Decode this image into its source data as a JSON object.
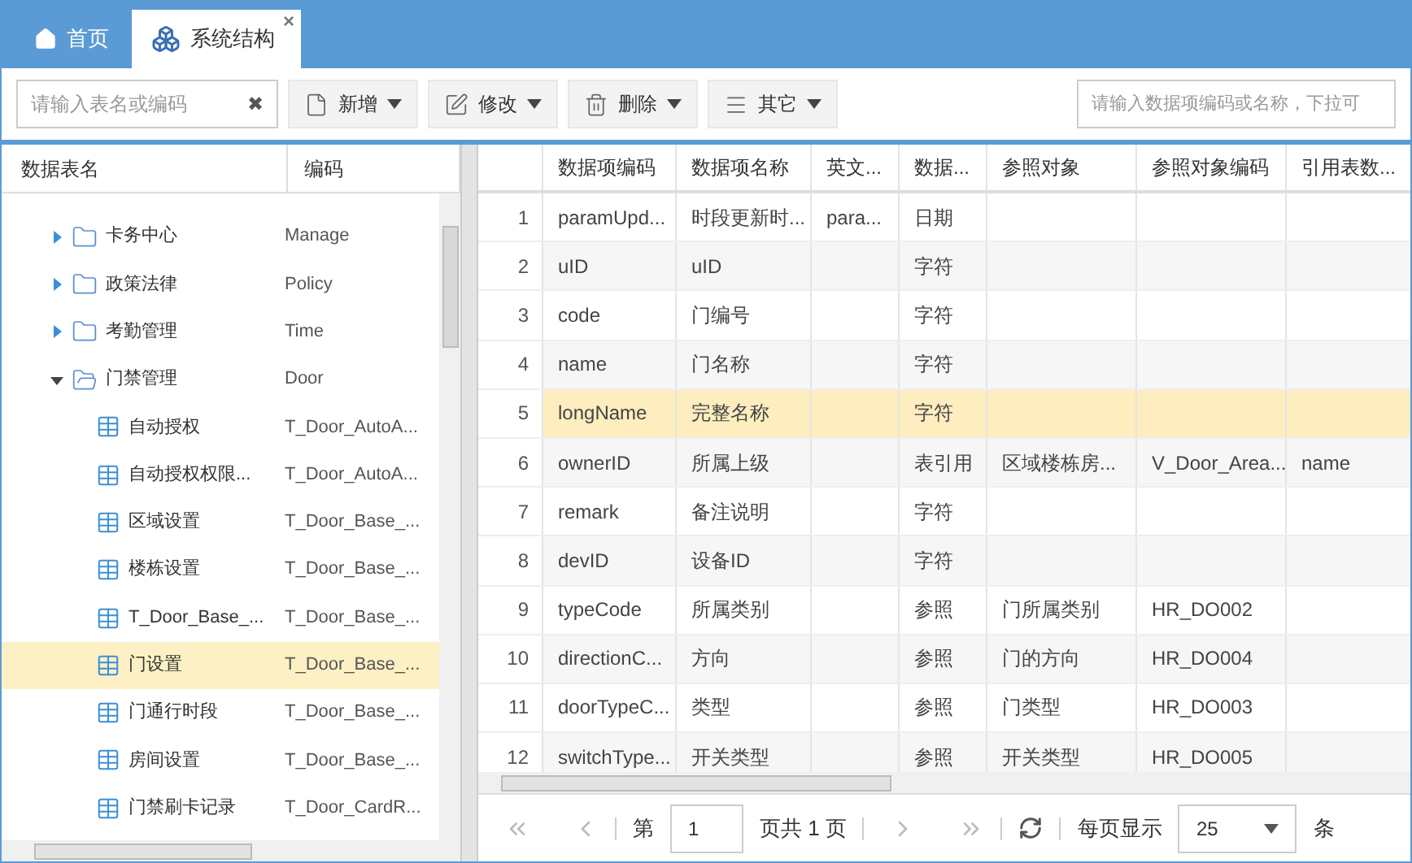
{
  "tabs": [
    {
      "label": "首页",
      "selected": false
    },
    {
      "label": "系统结构",
      "selected": true,
      "close": "×"
    }
  ],
  "toolbar": {
    "search": {
      "placeholder": "请输入表名或编码",
      "clear": "✖"
    },
    "buttons": [
      {
        "label": "新增"
      },
      {
        "label": "修改"
      },
      {
        "label": "删除"
      },
      {
        "label": "其它"
      }
    ],
    "item_search": {
      "placeholder": "请输入数据项编码或名称，下拉可"
    }
  },
  "tree": {
    "columns": [
      "数据表名",
      "编码"
    ],
    "items": [
      {
        "name": "卡务中心",
        "code": "Manage",
        "expanded": false,
        "selected": false
      },
      {
        "name": "政策法律",
        "code": "Policy",
        "expanded": false,
        "selected": false
      },
      {
        "name": "考勤管理",
        "code": "Time",
        "expanded": false,
        "selected": false
      },
      {
        "name": "门禁管理",
        "code": "Door",
        "expanded": true,
        "selected": false,
        "children": [
          {
            "name": "自动授权",
            "code": "T_Door_AutoA...",
            "selected": false
          },
          {
            "name": "自动授权权限...",
            "code": "T_Door_AutoA...",
            "selected": false
          },
          {
            "name": "区域设置",
            "code": "T_Door_Base_...",
            "selected": false
          },
          {
            "name": "楼栋设置",
            "code": "T_Door_Base_...",
            "selected": false
          },
          {
            "name": "T_Door_Base_...",
            "code": "T_Door_Base_...",
            "selected": false
          },
          {
            "name": "门设置",
            "code": "T_Door_Base_...",
            "selected": true
          },
          {
            "name": "门通行时段",
            "code": "T_Door_Base_...",
            "selected": false
          },
          {
            "name": "房间设置",
            "code": "T_Door_Base_...",
            "selected": false
          },
          {
            "name": "门禁刷卡记录",
            "code": "T_Door_CardR...",
            "selected": false
          }
        ]
      }
    ]
  },
  "table": {
    "columns": [
      "数据项编码",
      "数据项名称",
      "英文...",
      "数据...",
      "参照对象",
      "参照对象编码",
      "引用表数..."
    ],
    "rows": [
      {
        "num": "1",
        "cells": [
          "paramUpd...",
          "时段更新时...",
          "para...",
          "日期",
          "",
          "",
          ""
        ],
        "selected": false
      },
      {
        "num": "2",
        "cells": [
          "uID",
          "uID",
          "",
          "字符",
          "",
          "",
          ""
        ],
        "selected": false
      },
      {
        "num": "3",
        "cells": [
          "code",
          "门编号",
          "",
          "字符",
          "",
          "",
          ""
        ],
        "selected": false
      },
      {
        "num": "4",
        "cells": [
          "name",
          "门名称",
          "",
          "字符",
          "",
          "",
          ""
        ],
        "selected": false
      },
      {
        "num": "5",
        "cells": [
          "longName",
          "完整名称",
          "",
          "字符",
          "",
          "",
          ""
        ],
        "selected": true
      },
      {
        "num": "6",
        "cells": [
          "ownerID",
          "所属上级",
          "",
          "表引用",
          "区域楼栋房...",
          "V_Door_Area...",
          "name"
        ],
        "selected": false
      },
      {
        "num": "7",
        "cells": [
          "remark",
          "备注说明",
          "",
          "字符",
          "",
          "",
          ""
        ],
        "selected": false
      },
      {
        "num": "8",
        "cells": [
          "devID",
          "设备ID",
          "",
          "字符",
          "",
          "",
          ""
        ],
        "selected": false
      },
      {
        "num": "9",
        "cells": [
          "typeCode",
          "所属类别",
          "",
          "参照",
          "门所属类别",
          "HR_DO002",
          ""
        ],
        "selected": false
      },
      {
        "num": "10",
        "cells": [
          "directionC...",
          "方向",
          "",
          "参照",
          "门的方向",
          "HR_DO004",
          ""
        ],
        "selected": false
      },
      {
        "num": "11",
        "cells": [
          "doorTypeC...",
          "类型",
          "",
          "参照",
          "门类型",
          "HR_DO003",
          ""
        ],
        "selected": false
      },
      {
        "num": "12",
        "cells": [
          "switchType...",
          "开关类型",
          "",
          "参照",
          "开关类型",
          "HR_DO005",
          ""
        ],
        "selected": false
      }
    ]
  },
  "pager": {
    "page_prefix": "第",
    "page": "1",
    "page_suffix": "页共 1 页",
    "per_page_label": "每页显示",
    "per_page": "25",
    "unit": "条"
  }
}
